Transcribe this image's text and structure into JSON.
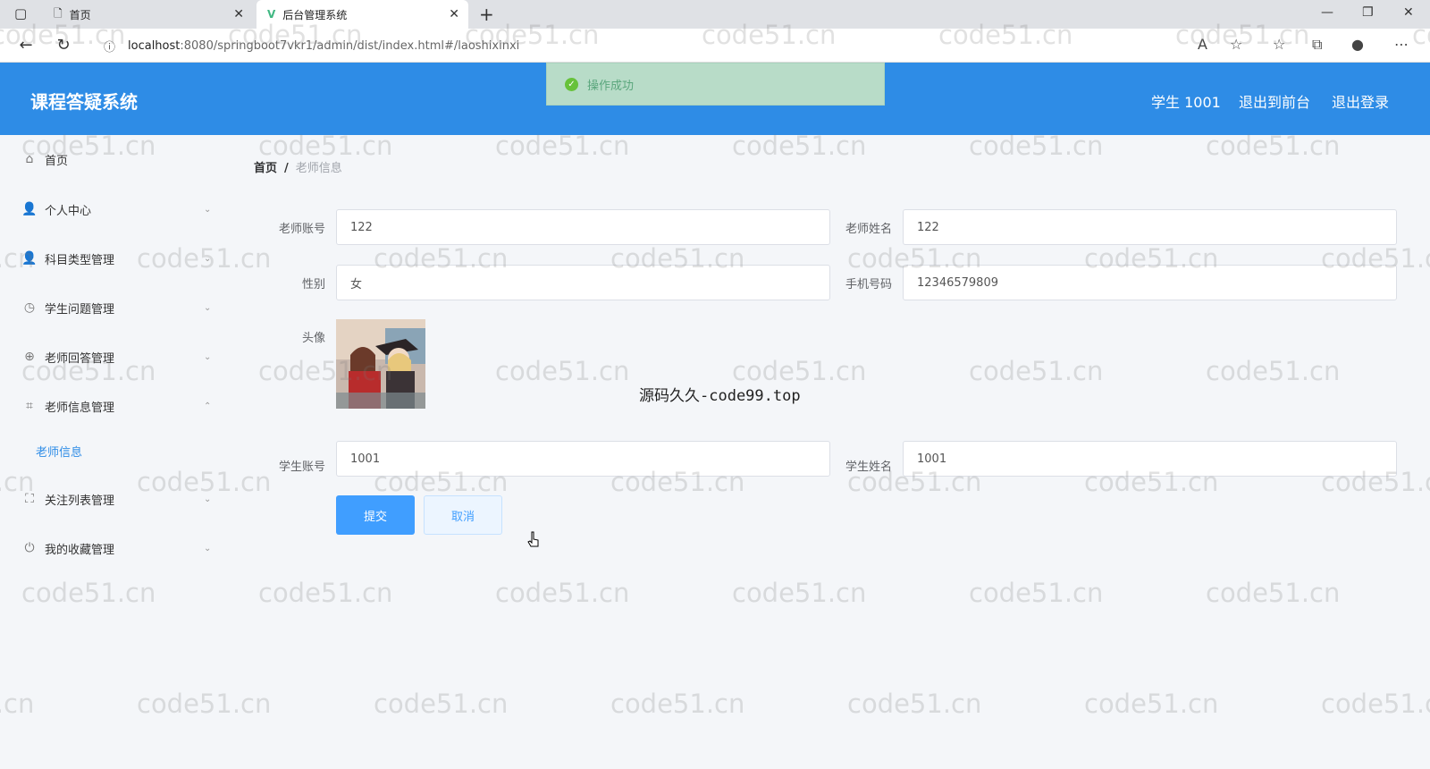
{
  "browser": {
    "tabs": [
      {
        "label": "首页",
        "icon": "page-icon"
      },
      {
        "label": "后台管理系统",
        "icon": "vue-logo-icon"
      }
    ],
    "url_host": "localhost",
    "url_rest": ":8080/springboot7vkr1/admin/dist/index.html#/laoshixinxi"
  },
  "header": {
    "title": "课程答疑系统",
    "user": "学生 1001",
    "back_front": "退出到前台",
    "logout": "退出登录"
  },
  "toast": {
    "message": "操作成功"
  },
  "sidebar": {
    "items": [
      {
        "label": "首页",
        "icon": "home-icon"
      },
      {
        "label": "个人中心",
        "icon": "user-icon"
      },
      {
        "label": "科目类型管理",
        "icon": "user-icon"
      },
      {
        "label": "学生问题管理",
        "icon": "compass-icon"
      },
      {
        "label": "老师回答管理",
        "icon": "crosshair-icon"
      },
      {
        "label": "老师信息管理",
        "icon": "crop-icon"
      },
      {
        "label": "关注列表管理",
        "icon": "fullscreen-icon"
      },
      {
        "label": "我的收藏管理",
        "icon": "power-icon"
      }
    ],
    "sub_item": "老师信息"
  },
  "breadcrumb": {
    "home": "首页",
    "separator": "/",
    "current": "老师信息"
  },
  "form": {
    "teacher_account_label": "老师账号",
    "teacher_account_value": "122",
    "teacher_name_label": "老师姓名",
    "teacher_name_value": "122",
    "gender_label": "性别",
    "gender_value": "女",
    "phone_label": "手机号码",
    "phone_value": "12346579809",
    "avatar_label": "头像",
    "student_account_label": "学生账号",
    "student_account_value": "1001",
    "student_name_label": "学生姓名",
    "student_name_value": "1001",
    "submit": "提交",
    "cancel": "取消"
  },
  "watermark": {
    "text": "code51.cn",
    "center_text": "源码久久-code99.top"
  },
  "colors": {
    "header": "#2e8ce6",
    "primary": "#409eff",
    "toast_bg": "#b8dcc8",
    "success": "#67c23a"
  }
}
